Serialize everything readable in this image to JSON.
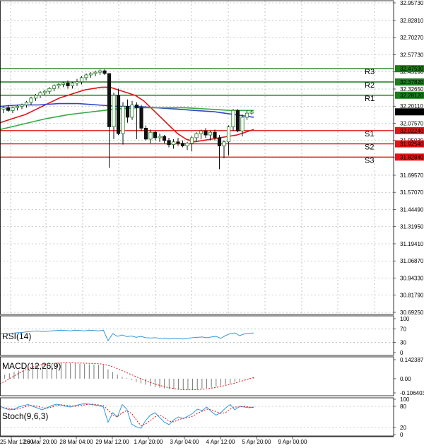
{
  "colors": {
    "bull": "#1b7d1b",
    "bear": "#e01515",
    "ma_fast": "#e01515",
    "ma_mid": "#3344cc",
    "ma_slow": "#33aa44",
    "resistance": "#1b7d1b",
    "support": "#e01515",
    "indicator_line": "#3399dd",
    "signal_line": "#e01515",
    "grid": "#9aa0a6"
  },
  "chart_data": [
    {
      "type": "candlestick",
      "price_axis": {
        "ylim": [
          30.6925,
          32.9573
        ],
        "tick_labels": [
          "32.95730",
          "32.82810",
          "32.70270",
          "32.57730",
          "32.45190",
          "32.32650",
          "32.20110",
          "32.07570",
          "31.95030",
          "31.82490",
          "31.69570",
          "31.57070",
          "31.44490",
          "31.31950",
          "31.19410",
          "31.06870",
          "30.94330",
          "30.81790",
          "30.69250"
        ]
      },
      "time_axis": {
        "tick_labels": [
          "25 Mar 12:00",
          "26 Mar 20:00",
          "28 Mar 04:00",
          "29 Mar 12:00",
          "1 Apr 20:00",
          "3 Apr 04:00",
          "4 Apr 12:00",
          "5 Apr 20:00",
          "9 Apr 00:00"
        ]
      },
      "current_price": {
        "value": 32.15952,
        "label": "32.15952"
      },
      "levels": [
        {
          "name": "R3",
          "value": 32.4753,
          "label": "32.47530",
          "kind": "resistance"
        },
        {
          "name": "R2",
          "value": 32.3782,
          "label": "32.37820",
          "kind": "resistance"
        },
        {
          "name": "R1",
          "value": 32.2812,
          "label": "32.28120",
          "kind": "resistance"
        },
        {
          "name": "S1",
          "value": 32.0224,
          "label": "32.02240",
          "kind": "support"
        },
        {
          "name": "S2",
          "value": 31.9254,
          "label": "31.92540",
          "kind": "support"
        },
        {
          "name": "S3",
          "value": 31.8284,
          "label": "31.82840",
          "kind": "support"
        }
      ],
      "candles": [
        [
          32.18,
          32.2,
          32.15,
          32.19
        ],
        [
          32.19,
          32.21,
          32.16,
          32.17
        ],
        [
          32.17,
          32.2,
          32.15,
          32.19
        ],
        [
          32.19,
          32.21,
          32.17,
          32.2
        ],
        [
          32.2,
          32.22,
          32.18,
          32.21
        ],
        [
          32.21,
          32.24,
          32.19,
          32.23
        ],
        [
          32.23,
          32.27,
          32.21,
          32.26
        ],
        [
          32.26,
          32.29,
          32.24,
          32.28
        ],
        [
          32.28,
          32.31,
          32.26,
          32.3
        ],
        [
          32.3,
          32.32,
          32.28,
          32.31
        ],
        [
          32.31,
          32.34,
          32.29,
          32.33
        ],
        [
          32.33,
          32.36,
          32.31,
          32.35
        ],
        [
          32.35,
          32.37,
          32.33,
          32.36
        ],
        [
          32.36,
          32.38,
          32.34,
          32.37
        ],
        [
          32.37,
          32.39,
          32.33,
          32.35
        ],
        [
          32.35,
          32.38,
          32.33,
          32.37
        ],
        [
          32.37,
          32.4,
          32.35,
          32.38
        ],
        [
          32.38,
          32.42,
          32.36,
          32.41
        ],
        [
          32.41,
          32.44,
          32.39,
          32.43
        ],
        [
          32.43,
          32.45,
          32.41,
          32.44
        ],
        [
          32.44,
          32.46,
          32.42,
          32.45
        ],
        [
          32.45,
          32.47,
          32.43,
          32.46
        ],
        [
          32.46,
          32.47,
          32.43,
          32.44
        ],
        [
          32.44,
          32.05,
          31.75,
          32.05
        ],
        [
          32.05,
          32.3,
          31.96,
          32.28
        ],
        [
          32.28,
          32.33,
          31.99,
          32.0
        ],
        [
          32.0,
          32.23,
          31.92,
          32.2
        ],
        [
          32.2,
          32.25,
          32.08,
          32.12
        ],
        [
          32.12,
          32.24,
          32.1,
          32.21
        ],
        [
          32.21,
          32.23,
          31.96,
          32.19
        ],
        [
          32.19,
          32.21,
          32.02,
          32.04
        ],
        [
          32.04,
          32.06,
          31.95,
          31.96
        ],
        [
          31.96,
          32.03,
          31.93,
          32.01
        ],
        [
          32.01,
          32.02,
          31.95,
          31.97
        ],
        [
          31.97,
          32.0,
          31.94,
          31.98
        ],
        [
          31.98,
          31.99,
          31.93,
          31.95
        ],
        [
          31.95,
          31.97,
          31.9,
          31.92
        ],
        [
          31.92,
          31.96,
          31.89,
          31.94
        ],
        [
          31.94,
          31.97,
          31.91,
          31.93
        ],
        [
          31.93,
          31.95,
          31.9,
          31.91
        ],
        [
          31.91,
          31.94,
          31.88,
          31.93
        ],
        [
          31.93,
          31.98,
          31.87,
          31.97
        ],
        [
          31.97,
          32.01,
          31.94,
          32.0
        ],
        [
          32.0,
          32.03,
          31.96,
          32.02
        ],
        [
          32.02,
          32.04,
          31.97,
          31.99
        ],
        [
          31.99,
          32.02,
          31.95,
          32.01
        ],
        [
          32.01,
          32.03,
          31.95,
          31.97
        ],
        [
          31.97,
          31.99,
          31.74,
          31.91
        ],
        [
          31.91,
          31.95,
          31.82,
          31.94
        ],
        [
          31.94,
          32.06,
          31.84,
          32.05
        ],
        [
          32.05,
          32.18,
          32.02,
          32.17
        ],
        [
          32.17,
          32.18,
          32.01,
          32.02
        ],
        [
          32.02,
          32.14,
          31.98,
          32.12
        ],
        [
          32.12,
          32.17,
          32.1,
          32.15
        ],
        [
          32.15,
          32.17,
          32.14,
          32.16
        ]
      ],
      "series": [
        {
          "color_key": "ma_fast",
          "values": [
            32.08,
            32.1,
            32.12,
            32.14,
            32.17,
            32.2,
            32.23,
            32.26,
            32.28,
            32.3,
            32.32,
            32.33,
            32.34,
            32.34,
            32.32,
            32.3,
            32.28,
            32.24,
            32.18,
            32.12,
            32.06,
            32.0,
            31.96,
            31.94,
            31.95,
            31.96,
            31.97,
            31.98,
            31.99,
            32.01,
            32.03
          ]
        },
        {
          "color_key": "ma_mid",
          "values": [
            32.2,
            32.21,
            32.21,
            32.22,
            32.22,
            32.21,
            32.2,
            32.2,
            32.19,
            32.18,
            32.17,
            32.16,
            32.14,
            32.12
          ]
        },
        {
          "color_key": "ma_slow",
          "values": [
            32.03,
            32.07,
            32.11,
            32.14,
            32.16,
            32.18,
            32.19,
            32.19,
            32.19,
            32.18,
            32.17,
            32.17
          ]
        }
      ]
    },
    {
      "type": "line",
      "label": "RSI(14)",
      "ylim": [
        0,
        100
      ],
      "tick_labels": [
        "100",
        "70",
        "30",
        "0"
      ],
      "series": [
        {
          "color_key": "indicator_line",
          "values": [
            55,
            57,
            56,
            58,
            59,
            60,
            62,
            63,
            64,
            62,
            63,
            64,
            65,
            66,
            65,
            64,
            66,
            65,
            64,
            66,
            65,
            64,
            66,
            35,
            56,
            48,
            52,
            47,
            49,
            45,
            48,
            44,
            43,
            44,
            42,
            43,
            40,
            42,
            41,
            40,
            42,
            44,
            45,
            46,
            44,
            46,
            48,
            42,
            50,
            56,
            58,
            50,
            55,
            57,
            58
          ]
        }
      ]
    },
    {
      "type": "bar",
      "label": "MACD(12,26,9)",
      "ylim": [
        -0.106403,
        0.142387
      ],
      "tick_labels": [
        "0.142387",
        "0.00",
        "-0.106403"
      ],
      "values": [
        0.02,
        0.03,
        0.04,
        0.05,
        0.06,
        0.07,
        0.08,
        0.09,
        0.095,
        0.1,
        0.105,
        0.11,
        0.115,
        0.12,
        0.12,
        0.118,
        0.115,
        0.112,
        0.11,
        0.108,
        0.106,
        0.104,
        0.102,
        0.07,
        0.05,
        0.03,
        0.015,
        0.005,
        -0.01,
        -0.025,
        -0.035,
        -0.045,
        -0.055,
        -0.062,
        -0.068,
        -0.073,
        -0.077,
        -0.08,
        -0.082,
        -0.083,
        -0.083,
        -0.081,
        -0.078,
        -0.074,
        -0.07,
        -0.065,
        -0.058,
        -0.052,
        -0.045,
        -0.036,
        -0.025,
        -0.015,
        -0.005,
        0.004,
        0.01
      ],
      "signal": {
        "color_key": "signal_line",
        "values": [
          -0.04,
          -0.02,
          0.0,
          0.02,
          0.04,
          0.06,
          0.075,
          0.088,
          0.098,
          0.106,
          0.11,
          0.114,
          0.116,
          0.118,
          0.119,
          0.119,
          0.118,
          0.117,
          0.116,
          0.115,
          0.114,
          0.112,
          0.108,
          0.1,
          0.09,
          0.075,
          0.06,
          0.045,
          0.03,
          0.015,
          0.0,
          -0.015,
          -0.028,
          -0.04,
          -0.05,
          -0.06,
          -0.068,
          -0.074,
          -0.079,
          -0.082,
          -0.083,
          -0.083,
          -0.082,
          -0.079,
          -0.076,
          -0.071,
          -0.065,
          -0.058,
          -0.05,
          -0.042,
          -0.033,
          -0.023,
          -0.012,
          -0.002,
          0.008
        ]
      }
    },
    {
      "type": "line",
      "label": "Stoch(9,6,3)",
      "ylim": [
        0,
        100
      ],
      "tick_labels": [
        "100",
        "80",
        "20",
        "0"
      ],
      "series": [
        {
          "color_key": "indicator_line",
          "values": [
            80,
            75,
            70,
            72,
            78,
            82,
            85,
            80,
            75,
            70,
            76,
            82,
            86,
            84,
            80,
            78,
            82,
            85,
            88,
            86,
            84,
            82,
            78,
            35,
            62,
            50,
            85,
            72,
            30,
            22,
            18,
            40,
            55,
            62,
            48,
            35,
            28,
            42,
            50,
            45,
            52,
            60,
            72,
            68,
            78,
            65,
            55,
            62,
            75,
            85,
            70,
            80,
            78,
            76,
            78
          ]
        },
        {
          "color_key": "signal_line",
          "values": [
            75,
            76,
            74,
            71,
            73,
            77,
            81,
            82,
            80,
            76,
            75,
            78,
            82,
            84,
            83,
            81,
            80,
            82,
            84,
            86,
            86,
            84,
            82,
            70,
            55,
            50,
            62,
            68,
            60,
            42,
            25,
            30,
            40,
            50,
            55,
            48,
            38,
            36,
            42,
            46,
            48,
            52,
            60,
            66,
            72,
            70,
            65,
            60,
            62,
            72,
            78,
            78,
            80,
            78,
            77
          ]
        }
      ]
    }
  ]
}
